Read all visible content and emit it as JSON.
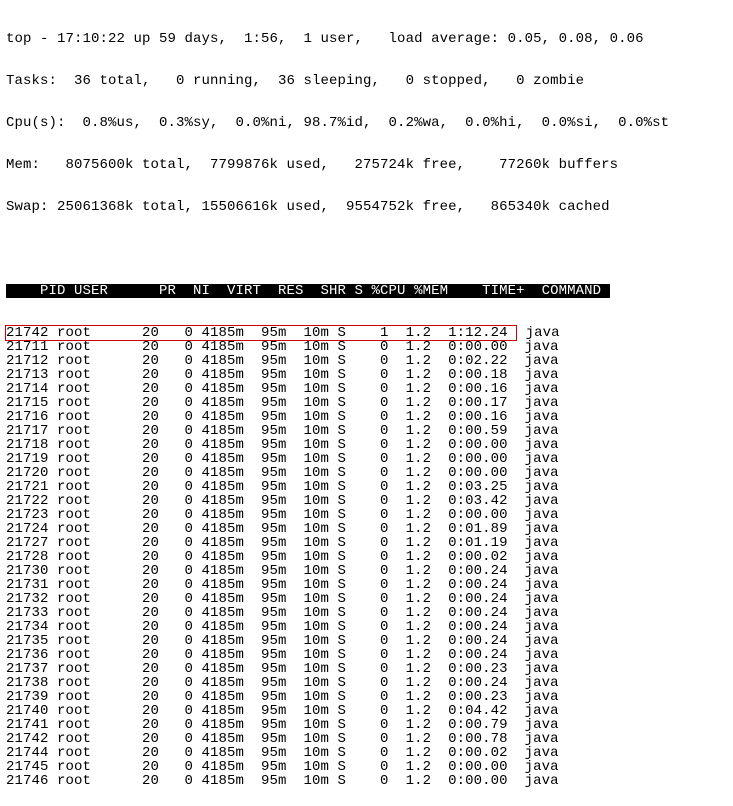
{
  "summary": {
    "line1": "top - 17:10:22 up 59 days,  1:56,  1 user,   load average: 0.05, 0.08, 0.06",
    "line2": "Tasks:  36 total,   0 running,  36 sleeping,   0 stopped,   0 zombie",
    "line3": "Cpu(s):  0.8%us,  0.3%sy,  0.0%ni, 98.7%id,  0.2%wa,  0.0%hi,  0.0%si,  0.0%st",
    "line4": "Mem:   8075600k total,  7799876k used,   275724k free,    77260k buffers",
    "line5": "Swap: 25061368k total, 15506616k used,  9554752k free,   865340k cached"
  },
  "columns": [
    "PID",
    "USER",
    "PR",
    "NI",
    "VIRT",
    "RES",
    "SHR",
    "S",
    "%CPU",
    "%MEM",
    "TIME+",
    "COMMAND"
  ],
  "highlight_pid": 21742,
  "processes": [
    {
      "pid": 21742,
      "user": "root",
      "pr": 20,
      "ni": 0,
      "virt": "4185m",
      "res": "95m",
      "shr": "10m",
      "s": "S",
      "cpu": "1",
      "mem": "1.2",
      "time": "1:12.24",
      "cmd": "java"
    },
    {
      "pid": 21711,
      "user": "root",
      "pr": 20,
      "ni": 0,
      "virt": "4185m",
      "res": "95m",
      "shr": "10m",
      "s": "S",
      "cpu": "0",
      "mem": "1.2",
      "time": "0:00.00",
      "cmd": "java"
    },
    {
      "pid": 21712,
      "user": "root",
      "pr": 20,
      "ni": 0,
      "virt": "4185m",
      "res": "95m",
      "shr": "10m",
      "s": "S",
      "cpu": "0",
      "mem": "1.2",
      "time": "0:02.22",
      "cmd": "java"
    },
    {
      "pid": 21713,
      "user": "root",
      "pr": 20,
      "ni": 0,
      "virt": "4185m",
      "res": "95m",
      "shr": "10m",
      "s": "S",
      "cpu": "0",
      "mem": "1.2",
      "time": "0:00.18",
      "cmd": "java"
    },
    {
      "pid": 21714,
      "user": "root",
      "pr": 20,
      "ni": 0,
      "virt": "4185m",
      "res": "95m",
      "shr": "10m",
      "s": "S",
      "cpu": "0",
      "mem": "1.2",
      "time": "0:00.16",
      "cmd": "java"
    },
    {
      "pid": 21715,
      "user": "root",
      "pr": 20,
      "ni": 0,
      "virt": "4185m",
      "res": "95m",
      "shr": "10m",
      "s": "S",
      "cpu": "0",
      "mem": "1.2",
      "time": "0:00.17",
      "cmd": "java"
    },
    {
      "pid": 21716,
      "user": "root",
      "pr": 20,
      "ni": 0,
      "virt": "4185m",
      "res": "95m",
      "shr": "10m",
      "s": "S",
      "cpu": "0",
      "mem": "1.2",
      "time": "0:00.16",
      "cmd": "java"
    },
    {
      "pid": 21717,
      "user": "root",
      "pr": 20,
      "ni": 0,
      "virt": "4185m",
      "res": "95m",
      "shr": "10m",
      "s": "S",
      "cpu": "0",
      "mem": "1.2",
      "time": "0:00.59",
      "cmd": "java"
    },
    {
      "pid": 21718,
      "user": "root",
      "pr": 20,
      "ni": 0,
      "virt": "4185m",
      "res": "95m",
      "shr": "10m",
      "s": "S",
      "cpu": "0",
      "mem": "1.2",
      "time": "0:00.00",
      "cmd": "java"
    },
    {
      "pid": 21719,
      "user": "root",
      "pr": 20,
      "ni": 0,
      "virt": "4185m",
      "res": "95m",
      "shr": "10m",
      "s": "S",
      "cpu": "0",
      "mem": "1.2",
      "time": "0:00.00",
      "cmd": "java"
    },
    {
      "pid": 21720,
      "user": "root",
      "pr": 20,
      "ni": 0,
      "virt": "4185m",
      "res": "95m",
      "shr": "10m",
      "s": "S",
      "cpu": "0",
      "mem": "1.2",
      "time": "0:00.00",
      "cmd": "java"
    },
    {
      "pid": 21721,
      "user": "root",
      "pr": 20,
      "ni": 0,
      "virt": "4185m",
      "res": "95m",
      "shr": "10m",
      "s": "S",
      "cpu": "0",
      "mem": "1.2",
      "time": "0:03.25",
      "cmd": "java"
    },
    {
      "pid": 21722,
      "user": "root",
      "pr": 20,
      "ni": 0,
      "virt": "4185m",
      "res": "95m",
      "shr": "10m",
      "s": "S",
      "cpu": "0",
      "mem": "1.2",
      "time": "0:03.42",
      "cmd": "java"
    },
    {
      "pid": 21723,
      "user": "root",
      "pr": 20,
      "ni": 0,
      "virt": "4185m",
      "res": "95m",
      "shr": "10m",
      "s": "S",
      "cpu": "0",
      "mem": "1.2",
      "time": "0:00.00",
      "cmd": "java"
    },
    {
      "pid": 21724,
      "user": "root",
      "pr": 20,
      "ni": 0,
      "virt": "4185m",
      "res": "95m",
      "shr": "10m",
      "s": "S",
      "cpu": "0",
      "mem": "1.2",
      "time": "0:01.89",
      "cmd": "java"
    },
    {
      "pid": 21727,
      "user": "root",
      "pr": 20,
      "ni": 0,
      "virt": "4185m",
      "res": "95m",
      "shr": "10m",
      "s": "S",
      "cpu": "0",
      "mem": "1.2",
      "time": "0:01.19",
      "cmd": "java"
    },
    {
      "pid": 21728,
      "user": "root",
      "pr": 20,
      "ni": 0,
      "virt": "4185m",
      "res": "95m",
      "shr": "10m",
      "s": "S",
      "cpu": "0",
      "mem": "1.2",
      "time": "0:00.02",
      "cmd": "java"
    },
    {
      "pid": 21730,
      "user": "root",
      "pr": 20,
      "ni": 0,
      "virt": "4185m",
      "res": "95m",
      "shr": "10m",
      "s": "S",
      "cpu": "0",
      "mem": "1.2",
      "time": "0:00.24",
      "cmd": "java"
    },
    {
      "pid": 21731,
      "user": "root",
      "pr": 20,
      "ni": 0,
      "virt": "4185m",
      "res": "95m",
      "shr": "10m",
      "s": "S",
      "cpu": "0",
      "mem": "1.2",
      "time": "0:00.24",
      "cmd": "java"
    },
    {
      "pid": 21732,
      "user": "root",
      "pr": 20,
      "ni": 0,
      "virt": "4185m",
      "res": "95m",
      "shr": "10m",
      "s": "S",
      "cpu": "0",
      "mem": "1.2",
      "time": "0:00.24",
      "cmd": "java"
    },
    {
      "pid": 21733,
      "user": "root",
      "pr": 20,
      "ni": 0,
      "virt": "4185m",
      "res": "95m",
      "shr": "10m",
      "s": "S",
      "cpu": "0",
      "mem": "1.2",
      "time": "0:00.24",
      "cmd": "java"
    },
    {
      "pid": 21734,
      "user": "root",
      "pr": 20,
      "ni": 0,
      "virt": "4185m",
      "res": "95m",
      "shr": "10m",
      "s": "S",
      "cpu": "0",
      "mem": "1.2",
      "time": "0:00.24",
      "cmd": "java"
    },
    {
      "pid": 21735,
      "user": "root",
      "pr": 20,
      "ni": 0,
      "virt": "4185m",
      "res": "95m",
      "shr": "10m",
      "s": "S",
      "cpu": "0",
      "mem": "1.2",
      "time": "0:00.24",
      "cmd": "java"
    },
    {
      "pid": 21736,
      "user": "root",
      "pr": 20,
      "ni": 0,
      "virt": "4185m",
      "res": "95m",
      "shr": "10m",
      "s": "S",
      "cpu": "0",
      "mem": "1.2",
      "time": "0:00.24",
      "cmd": "java"
    },
    {
      "pid": 21737,
      "user": "root",
      "pr": 20,
      "ni": 0,
      "virt": "4185m",
      "res": "95m",
      "shr": "10m",
      "s": "S",
      "cpu": "0",
      "mem": "1.2",
      "time": "0:00.23",
      "cmd": "java"
    },
    {
      "pid": 21738,
      "user": "root",
      "pr": 20,
      "ni": 0,
      "virt": "4185m",
      "res": "95m",
      "shr": "10m",
      "s": "S",
      "cpu": "0",
      "mem": "1.2",
      "time": "0:00.24",
      "cmd": "java"
    },
    {
      "pid": 21739,
      "user": "root",
      "pr": 20,
      "ni": 0,
      "virt": "4185m",
      "res": "95m",
      "shr": "10m",
      "s": "S",
      "cpu": "0",
      "mem": "1.2",
      "time": "0:00.23",
      "cmd": "java"
    },
    {
      "pid": 21740,
      "user": "root",
      "pr": 20,
      "ni": 0,
      "virt": "4185m",
      "res": "95m",
      "shr": "10m",
      "s": "S",
      "cpu": "0",
      "mem": "1.2",
      "time": "0:04.42",
      "cmd": "java"
    },
    {
      "pid": 21741,
      "user": "root",
      "pr": 20,
      "ni": 0,
      "virt": "4185m",
      "res": "95m",
      "shr": "10m",
      "s": "S",
      "cpu": "0",
      "mem": "1.2",
      "time": "0:00.79",
      "cmd": "java"
    },
    {
      "pid": 21742,
      "user": "root",
      "pr": 20,
      "ni": 0,
      "virt": "4185m",
      "res": "95m",
      "shr": "10m",
      "s": "S",
      "cpu": "0",
      "mem": "1.2",
      "time": "0:00.78",
      "cmd": "java"
    },
    {
      "pid": 21744,
      "user": "root",
      "pr": 20,
      "ni": 0,
      "virt": "4185m",
      "res": "95m",
      "shr": "10m",
      "s": "S",
      "cpu": "0",
      "mem": "1.2",
      "time": "0:00.02",
      "cmd": "java"
    },
    {
      "pid": 21745,
      "user": "root",
      "pr": 20,
      "ni": 0,
      "virt": "4185m",
      "res": "95m",
      "shr": "10m",
      "s": "S",
      "cpu": "0",
      "mem": "1.2",
      "time": "0:00.00",
      "cmd": "java"
    },
    {
      "pid": 21746,
      "user": "root",
      "pr": 20,
      "ni": 0,
      "virt": "4185m",
      "res": "95m",
      "shr": "10m",
      "s": "S",
      "cpu": "0",
      "mem": "1.2",
      "time": "0:00.00",
      "cmd": "java"
    }
  ]
}
